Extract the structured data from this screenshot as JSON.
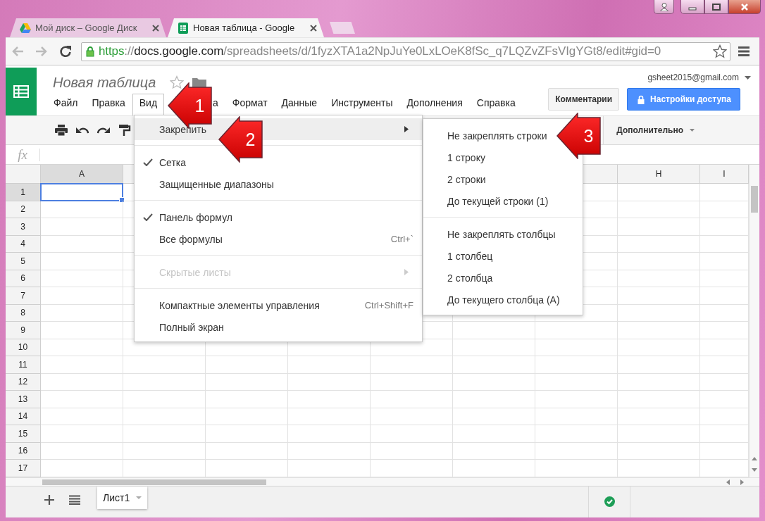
{
  "browser": {
    "tabs": [
      {
        "title": "Мой диск – Google Диск",
        "kind": "drive",
        "selected": false
      },
      {
        "title": "Новая таблица - Google",
        "kind": "sheets",
        "selected": true
      }
    ],
    "url": {
      "scheme": "https",
      "separator": "://",
      "host": "docs.google.com",
      "path": "/spreadsheets/d/1fyzXTA1a2NpJuYe0LxLOeK8fSc_q7LQZvZFsVIgYGt8/edit#gid=0"
    }
  },
  "document": {
    "title": "Новая таблица",
    "account": "gsheet2015@gmail.com"
  },
  "menu_bar": [
    {
      "label": "Файл",
      "selected": false,
      "covered": false
    },
    {
      "label": "Правка",
      "selected": false,
      "covered": false
    },
    {
      "label": "Вид",
      "selected": true,
      "covered": false
    },
    {
      "label": "а",
      "selected": false,
      "covered": true
    },
    {
      "label": "Формат",
      "selected": false,
      "covered": false
    },
    {
      "label": "Данные",
      "selected": false,
      "covered": false
    },
    {
      "label": "Инструменты",
      "selected": false,
      "covered": false
    },
    {
      "label": "Дополнения",
      "selected": false,
      "covered": false
    },
    {
      "label": "Справка",
      "selected": false,
      "covered": false
    }
  ],
  "buttons": [
    {
      "label": "Комментарии",
      "kind": "plain"
    },
    {
      "label": "Настройки доступа",
      "kind": "share"
    }
  ],
  "toolbar": {
    "more": "Дополнительно"
  },
  "formula_bar": {
    "label": "fx"
  },
  "grid": {
    "columns": [
      {
        "label": "A",
        "selected": true
      },
      {
        "label": "H",
        "selected": false
      },
      {
        "label": "I",
        "selected": false
      }
    ],
    "rows": [
      {
        "label": "1",
        "selected": true
      },
      {
        "label": "2",
        "selected": false
      },
      {
        "label": "3",
        "selected": false
      },
      {
        "label": "4",
        "selected": false
      },
      {
        "label": "5",
        "selected": false
      },
      {
        "label": "6",
        "selected": false
      },
      {
        "label": "7",
        "selected": false
      },
      {
        "label": "8",
        "selected": false
      },
      {
        "label": "9",
        "selected": false
      },
      {
        "label": "10",
        "selected": false
      },
      {
        "label": "11",
        "selected": false
      },
      {
        "label": "12",
        "selected": false
      },
      {
        "label": "13",
        "selected": false
      },
      {
        "label": "14",
        "selected": false
      },
      {
        "label": "15",
        "selected": false
      },
      {
        "label": "16",
        "selected": false
      },
      {
        "label": "17",
        "selected": false
      }
    ]
  },
  "sheet_tabs": [
    {
      "label": "Лист1",
      "selected": true
    }
  ],
  "view_menu": {
    "items": [
      {
        "kind": "item",
        "label": "Закрепить",
        "selected": true,
        "checked": false,
        "disabled": false,
        "submenu": true
      },
      {
        "kind": "separator"
      },
      {
        "kind": "item",
        "label": "Сетка",
        "selected": false,
        "checked": true,
        "disabled": false,
        "submenu": false
      },
      {
        "kind": "item",
        "label": "Защищенные диапазоны",
        "selected": false,
        "checked": false,
        "disabled": false,
        "submenu": false
      },
      {
        "kind": "separator"
      },
      {
        "kind": "item",
        "label": "Панель формул",
        "selected": false,
        "checked": true,
        "disabled": false,
        "submenu": false
      },
      {
        "kind": "item",
        "label": "Все формулы",
        "shortcut": "Ctrl+`",
        "selected": false,
        "checked": false,
        "disabled": false,
        "submenu": false
      },
      {
        "kind": "separator"
      },
      {
        "kind": "item",
        "label": "Скрытые листы",
        "selected": false,
        "checked": false,
        "disabled": true,
        "submenu": true
      },
      {
        "kind": "separator"
      },
      {
        "kind": "item",
        "label": "Компактные элементы управления",
        "shortcut": "Ctrl+Shift+F",
        "selected": false,
        "checked": false,
        "disabled": false,
        "submenu": false
      },
      {
        "kind": "item",
        "label": "Полный экран",
        "selected": false,
        "checked": false,
        "disabled": false,
        "submenu": false
      }
    ]
  },
  "freeze_menu": {
    "items": [
      {
        "kind": "item",
        "label": "Не закреплять строки",
        "selected": false
      },
      {
        "kind": "item",
        "label": "1 строку",
        "selected": false
      },
      {
        "kind": "item",
        "label": "2 строки",
        "selected": false
      },
      {
        "kind": "item",
        "label": "До текущей строки (1)",
        "selected": false
      },
      {
        "kind": "separator"
      },
      {
        "kind": "item",
        "label": "Не закреплять столбцы",
        "selected": false
      },
      {
        "kind": "item",
        "label": "1 столбец",
        "selected": false
      },
      {
        "kind": "item",
        "label": "2 столбца",
        "selected": false
      },
      {
        "kind": "item",
        "label": "До текущего столбца (А)",
        "selected": false
      }
    ]
  },
  "callouts": [
    {
      "label": "1"
    },
    {
      "label": "2"
    },
    {
      "label": "3"
    }
  ]
}
